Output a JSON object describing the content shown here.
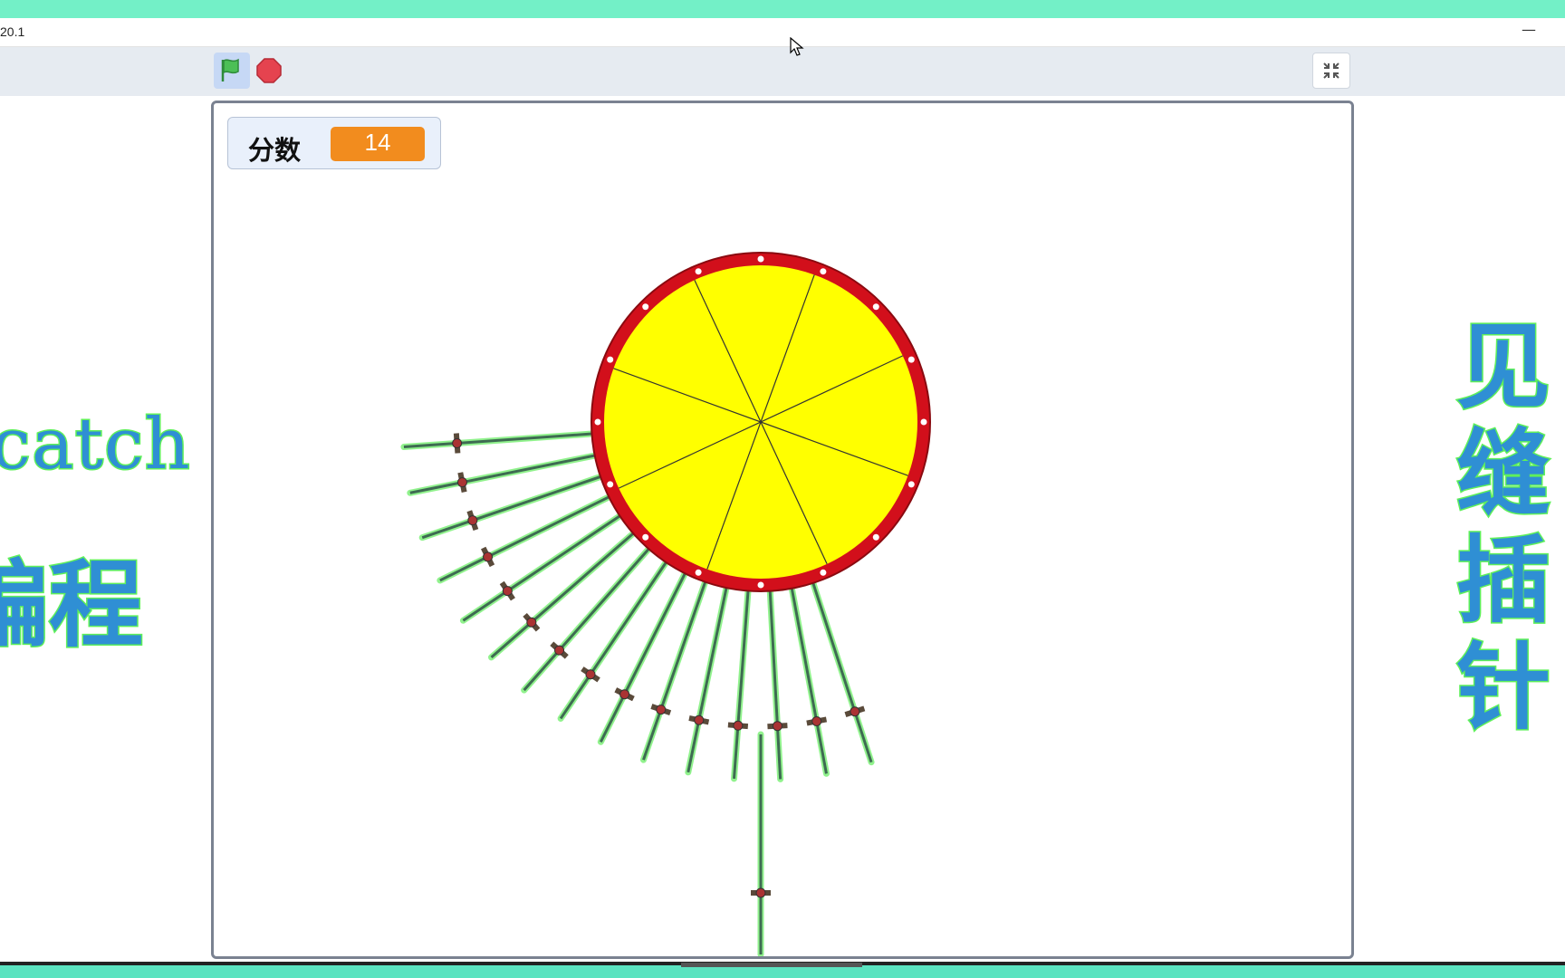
{
  "window": {
    "title": "20.1",
    "minimize_label": "—"
  },
  "toolbar": {
    "green_flag_icon": "green-flag-icon",
    "stop_icon": "stop-sign-icon",
    "fullscreen_icon": "shrink-arrows-icon"
  },
  "stage": {
    "score_label": "分数",
    "score_value": "14",
    "target_colors": {
      "rim": "#d20f1b",
      "face": "#ffff00",
      "spokes": "#333333"
    },
    "stuck_swords": 15,
    "ready_sword": 1
  },
  "overlay": {
    "left_brand": "rcatch",
    "left_cn": "编程",
    "right_title": "见缝插针"
  },
  "colors": {
    "accent_teal": "#73f0c7",
    "overlay_text": "#2f8fd4",
    "overlay_outline": "#5ff05a",
    "score_orange": "#f28c1e"
  }
}
